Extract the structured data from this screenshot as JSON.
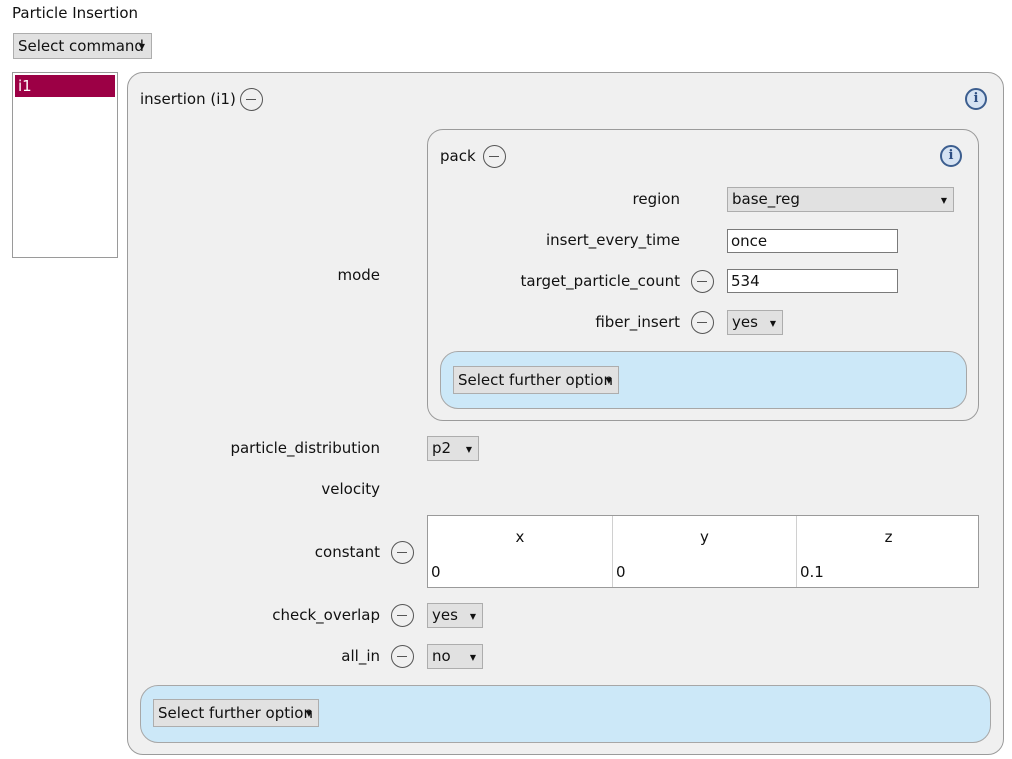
{
  "window": {
    "title": "Particle Insertion"
  },
  "toolbar": {
    "select_command": "Select command"
  },
  "list": {
    "items": [
      "i1"
    ]
  },
  "insertion": {
    "title": "insertion (i1)",
    "mode_label": "mode",
    "pack": {
      "title": "pack",
      "region_label": "region",
      "region_value": "base_reg",
      "insert_every_time_label": "insert_every_time",
      "insert_every_time_value": "once",
      "target_particle_count_label": "target_particle_count",
      "target_particle_count_value": "534",
      "fiber_insert_label": "fiber_insert",
      "fiber_insert_value": "yes",
      "further_option": "Select further option"
    },
    "particle_distribution_label": "particle_distribution",
    "particle_distribution_value": "p2",
    "velocity_label": "velocity",
    "constant_label": "constant",
    "constant_table": {
      "headers": [
        "x",
        "y",
        "z"
      ],
      "values": [
        "0",
        "0",
        "0.1"
      ]
    },
    "check_overlap_label": "check_overlap",
    "check_overlap_value": "yes",
    "all_in_label": "all_in",
    "all_in_value": "no",
    "further_option": "Select further option"
  }
}
